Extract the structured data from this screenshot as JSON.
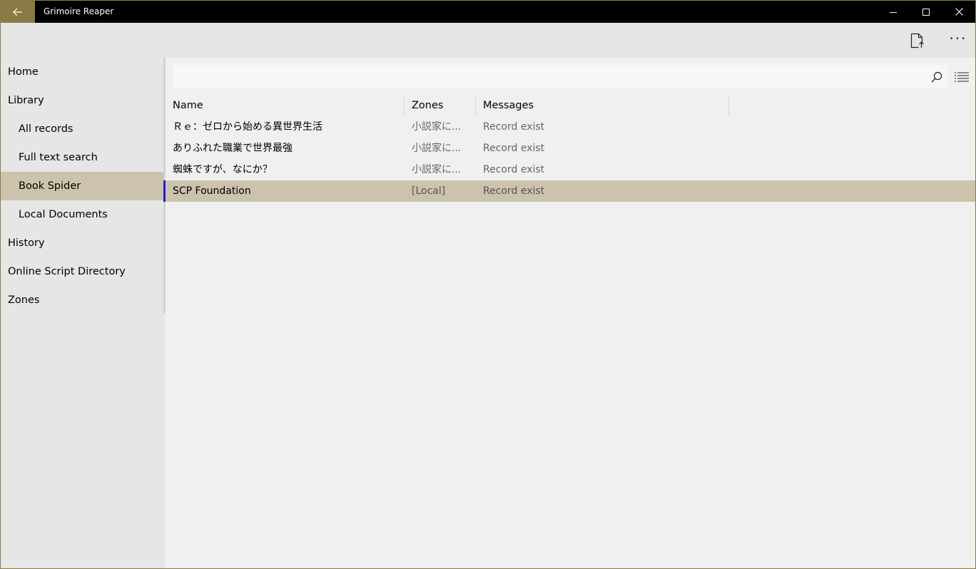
{
  "window": {
    "title": "Grimoire Reaper"
  },
  "colors": {
    "accent": "#8c7a45",
    "selection": "#ccc3ad",
    "row_indicator": "#1f1fd6",
    "titlebar": "#000000",
    "sidebar_bg": "#e6e6e6",
    "content_bg": "#f0f0f0"
  },
  "icons": {
    "back": "arrow-left-icon",
    "minimize": "minimize-icon",
    "maximize": "maximize-icon",
    "close": "close-icon",
    "export": "document-upload-icon",
    "more": "more-dots-icon",
    "search": "search-icon",
    "view_mode": "list-view-icon"
  },
  "commandbar": {
    "more_label": "···"
  },
  "sidebar": {
    "items": [
      {
        "label": "Home",
        "level": 1,
        "selected": false
      },
      {
        "label": "Library",
        "level": 1,
        "selected": false
      },
      {
        "label": "All records",
        "level": 2,
        "selected": false
      },
      {
        "label": "Full text search",
        "level": 2,
        "selected": false
      },
      {
        "label": "Book Spider",
        "level": 2,
        "selected": true
      },
      {
        "label": "Local Documents",
        "level": 2,
        "selected": false
      },
      {
        "label": "History",
        "level": 1,
        "selected": false
      },
      {
        "label": "Online Script Directory",
        "level": 1,
        "selected": false
      },
      {
        "label": "Zones",
        "level": 1,
        "selected": false
      }
    ]
  },
  "search": {
    "value": "",
    "placeholder": ""
  },
  "table": {
    "columns": [
      "Name",
      "Zones",
      "Messages"
    ],
    "rows": [
      {
        "name": "Ｒｅ：ゼロから始める異世界生活",
        "zone": "小説家に...",
        "message": "Record exist",
        "selected": false
      },
      {
        "name": "ありふれた職業で世界最強",
        "zone": "小説家に...",
        "message": "Record exist",
        "selected": false
      },
      {
        "name": "蜘蛛ですが、なにか？",
        "zone": "小説家に...",
        "message": "Record exist",
        "selected": false
      },
      {
        "name": "SCP Foundation",
        "zone": "[Local]",
        "message": "Record exist",
        "selected": true
      }
    ]
  }
}
